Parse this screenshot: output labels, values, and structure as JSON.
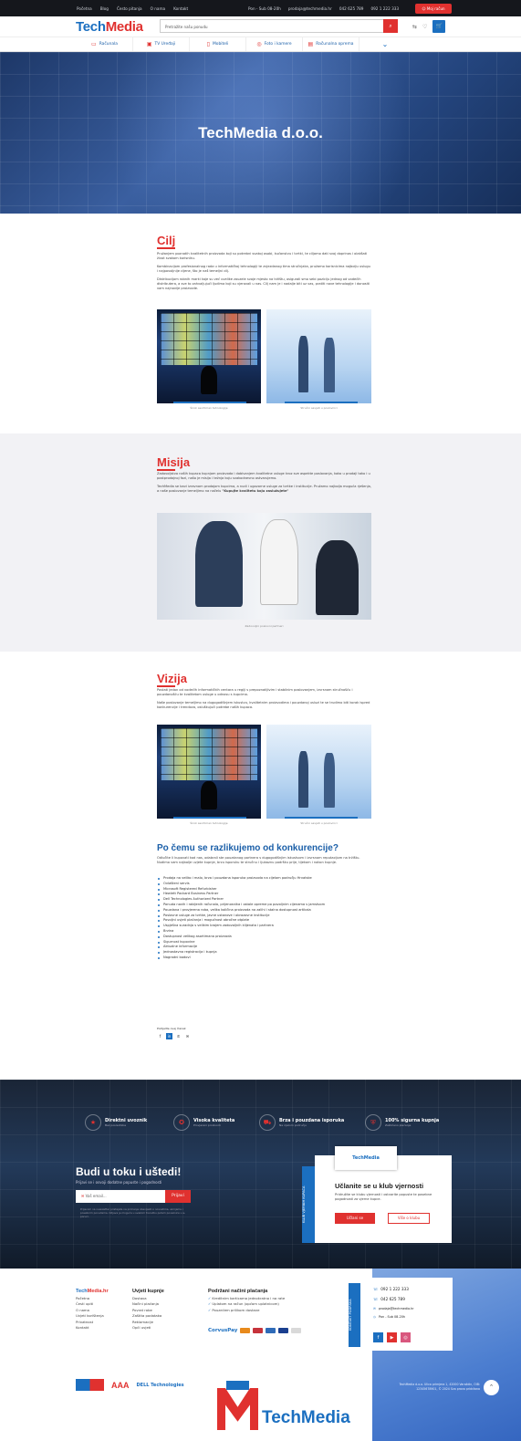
{
  "topbar": {
    "links": [
      "Početna",
      "Blog",
      "Često pitanja",
      "O nama",
      "Kontakt"
    ],
    "hours": "Pon - Sub 08-20h",
    "email": "prodaja@techmedia.hr",
    "phone1": "042 625 789",
    "phone2": "092 1 222 333",
    "login": "Moj račun"
  },
  "header": {
    "logo_a": "Tech",
    "logo_b": "Media",
    "search_placeholder": "Pretražite našu ponudu",
    "search_icon": "search-icon",
    "cart_icon": "cart-icon"
  },
  "nav": {
    "items": [
      "Računala",
      "TV Uređaji",
      "Mobiteli",
      "Foto i kamere",
      "Računalna oprema"
    ]
  },
  "hero": {
    "title": "TechMedia d.o.o."
  },
  "cilj": {
    "title": "Cilj",
    "p1": "Pružanjem poznatih kvalitetnih proizvoda koji su potrebni svakoj osobi, kućanstvu i tvrtki, te ciljamo dati svoj doprinos i olakšati život svakom korisniku.",
    "p2": "Kombinacijom profesionalnog rada u informatičkoj tehnologiji te zvjezdanog tima stručnjaka, pružamo korisnicima najbolju uslugu i najpovoljnije cijene, što je naš temeljni cilj.",
    "p3": "Distribucijom robnih marki koje su već uvelike zauzele svoje mjesto na tržištu, osigurali smo sebi poziciju jednog od vodećih distributera, a sve to zahvaljujući ljudima koji su vjerovali u nas. Cilj nam je i nadalje biti uz vas, pratiti nove tehnologije i donositi vam najnovije proizvode.",
    "cap1": "Širok asortiman tehnologije",
    "cap2": "Stručni savjeti u poslovnici"
  },
  "misija": {
    "title": "Misija",
    "p1": "Zadovoljstvo naših kupaca kupnjom proizvoda i dobivanjem kvalitetne usluge kroz sve aspekte poslovanja, kako u prodaji tako i u postprodajnoj fazi, naša je misija i težnja koju svakodnevno ostvarujemo.",
    "p2": "TechMedia se bavi izravnom prodajom kupcima, a nudi i ugovorne usluge za tvrtke i institucije. Pružamo najbolja moguća rješenja, a naše poslovanje temeljimo na načelu",
    "quote": "\"Kupujte kvalitetu koju zaslužujete\"",
    "cap": "Zadovoljni poslovni partneri"
  },
  "vizija": {
    "title": "Vizija",
    "p1": "Postati jedan od vodećih informatičkih centara u regiji s prepoznatljivim i stabilnim poslovanjem, izvrsnom stručnošću i pouzdanošću te kvalitetom usluge u odnosu s kupcima.",
    "p2": "Naše poslovanje temeljimo na dugogodišnjem iskustvu, kvalitetnim proizvodima i pouzdanoj usluzi te se trudimo biti korak ispred konkurencije i trendova, osluškujući potrebe naših kupaca.",
    "cap1": "Širok asortiman tehnologije",
    "cap2": "Stručni savjeti u poslovnici"
  },
  "razlika": {
    "title": "Po čemu se razlikujemo od konkurencije?",
    "intro": "Odlučite li kupovati kod nas, odabrali ste pouzdanog partnera s dugogodišnjim iskustvom i izvrsnom reputacijom na tržištu. Nudimo vam najbolje uvjete kupnje, brzu isporuku te stručnu i ljubaznu podršku prije, tijekom i nakon kupnje.",
    "items": [
      "Prodaja na veliko i malo, brza i pouzdana isporuka proizvoda na cijelom području Hrvatske",
      "Ovlašteni servis",
      "Microsoft Registered Refurbisher",
      "Hewlett Packard Business Partner",
      "Dell Technologies Authorized Partner",
      "Ponuda novih i rabljenih računala, prijenosnika i ostale opreme po povoljnim cijenama s jamstvom",
      "Pouzdana i provjerena roba, velika količina proizvoda na zalihi i stalna dostupnost artikala",
      "Poslovne usluge za tvrtke, javne ustanove i obrazovne institucije",
      "Povoljni uvjeti plaćanja i mogućnost obročne otplate",
      "Uspješna suradnja s velikim brojem zadovoljnih klijenata i partnera",
      "Brzina",
      "Dostupnost velikog asortimana proizvoda",
      "Sigurnost kupovine",
      "Aktualne informacije",
      "Jednostavna registracija i kupnja",
      "Nagradni bodovi"
    ],
    "share_label": "Podijelite ovaj članak"
  },
  "features": [
    {
      "title": "Direktni uvoznik",
      "sub": "Bez posrednika",
      "icon": "star-icon"
    },
    {
      "title": "Visoka kvaliteta",
      "sub": "Provjereni proizvodi",
      "icon": "medal-icon"
    },
    {
      "title": "Brza i pouzdana isporuka",
      "sub": "Na cijelom području",
      "icon": "truck-icon"
    },
    {
      "title": "100% sigurna kupnja",
      "sub": "Zaštićeno plaćanje",
      "icon": "shield-icon"
    }
  ],
  "newsletter": {
    "title": "Budi u toku i uštedi!",
    "sub": "Prijavi se i osvoji dodatne popuste i pogodnosti",
    "placeholder": "Vaš email...",
    "button": "Prijavi",
    "fine": "Prijavom na newsletter pristajete na primanje obavijesti o novostima, akcijama i posebnim ponudama. Odjava je moguća u svakom trenutku putem poveznice u e-poruci."
  },
  "club": {
    "strip": "KLUB VJERNIH KUPACA",
    "card": "TechMedia",
    "title": "Učlanite se u klub vjernosti",
    "desc": "Pridružite se klubu vjernosti i ostvarite popuste te posebne pogodnosti za vjerne kupce.",
    "btn1": "Učlani se",
    "btn2": "Više o klubu"
  },
  "footer": {
    "col1_title_a": "Tech",
    "col1_title_b": "Media.hr",
    "col1": [
      "Početna",
      "Česti upiti",
      "O nama",
      "Uvjeti korištenja",
      "Privatnost",
      "Kontakt"
    ],
    "col2_title": "Uvjeti kupnje",
    "col2": [
      "Dostava",
      "Načini plaćanja",
      "Povrat robe",
      "Zaštita podataka",
      "Reklamacije",
      "Opći uvjeti"
    ],
    "col3_title": "Podržani načini plaćanja",
    "col3": [
      "Kreditnim karticama jednokratno i na rate",
      "Uplatom na račun (općom uplatnicom)",
      "Pouzećem prilikom dostave"
    ],
    "corvus": "CorvusPay",
    "contact_strip": "KONTAKT PODRŠKA",
    "phone1": "092 1 222 333",
    "phone2": "042 625 789",
    "email": "prodaja@techmedia.hr",
    "hours": "Pon - Sub 08-20h",
    "partner_aaa": "AAA",
    "partner_dell": "DELL Technologies",
    "biglogo": "TechMedia",
    "company": "TechMedia d.o.o. Ulica primjera 1, 42000 Varaždin, OIB: 12345678901, © 2024 Sva prava pridržana"
  }
}
